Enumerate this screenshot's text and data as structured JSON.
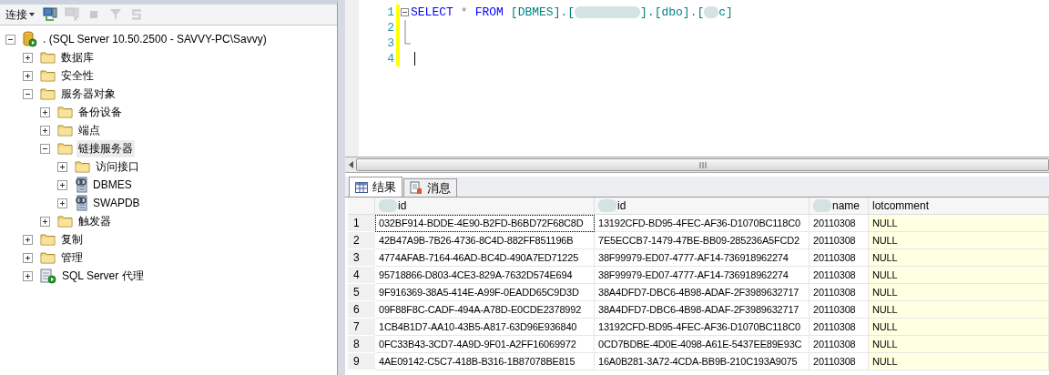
{
  "explorer": {
    "connect_label": "连接",
    "toolbar": [
      {
        "kind": "connect",
        "disabled": false
      },
      {
        "kind": "disconnect",
        "disabled": true
      },
      {
        "kind": "stop",
        "disabled": true
      },
      {
        "kind": "filter",
        "disabled": true
      },
      {
        "kind": "refresh",
        "disabled": true
      }
    ],
    "tree": [
      {
        "label": ". (SQL Server 10.50.2500 - SAVVY-PC\\Savvy)",
        "kind": "server",
        "expanded": true,
        "selected": false,
        "children": [
          {
            "label": "数据库",
            "kind": "folder",
            "expanded": false,
            "selected": false
          },
          {
            "label": "安全性",
            "kind": "folder",
            "expanded": false,
            "selected": false
          },
          {
            "label": "服务器对象",
            "kind": "folder",
            "expanded": true,
            "selected": false,
            "children": [
              {
                "label": "备份设备",
                "kind": "folder",
                "expanded": false,
                "selected": false
              },
              {
                "label": "端点",
                "kind": "folder",
                "expanded": false,
                "selected": false
              },
              {
                "label": "链接服务器",
                "kind": "folder",
                "expanded": true,
                "selected": true,
                "children": [
                  {
                    "label": "访问接口",
                    "kind": "folder",
                    "expanded": false,
                    "selected": false
                  },
                  {
                    "label": "DBMES",
                    "kind": "linked",
                    "expanded": false,
                    "selected": false
                  },
                  {
                    "label": "SWAPDB",
                    "kind": "linked",
                    "expanded": false,
                    "selected": false
                  }
                ]
              },
              {
                "label": "触发器",
                "kind": "folder",
                "expanded": false,
                "selected": false
              }
            ]
          },
          {
            "label": "复制",
            "kind": "folder",
            "expanded": false,
            "selected": false
          },
          {
            "label": "管理",
            "kind": "folder",
            "expanded": false,
            "selected": false
          },
          {
            "label": "SQL Server 代理",
            "kind": "agent",
            "expanded": false,
            "selected": false
          }
        ]
      }
    ]
  },
  "editor": {
    "lines": [
      {
        "number": "1",
        "kind": "fold_start",
        "caret": false,
        "tokens": [
          {
            "kind": "keyword",
            "text": "SELECT"
          },
          {
            "kind": "operator",
            "text": "*"
          },
          {
            "kind": "keyword",
            "text": "FROM"
          },
          {
            "kind": "identifier",
            "text": "[DBMES].["
          },
          {
            "kind": "redacted"
          },
          {
            "kind": "identifier",
            "text": "].[dbo].["
          },
          {
            "kind": "redacted"
          },
          {
            "kind": "identifier",
            "text": "c]"
          }
        ]
      },
      {
        "number": "2",
        "kind": "fold_middle",
        "caret": false
      },
      {
        "number": "3",
        "kind": "fold_end",
        "caret": false
      },
      {
        "number": "4",
        "kind": "plain",
        "caret": true
      }
    ]
  },
  "results": {
    "tabs": [
      {
        "label": "结果",
        "kind": "grid",
        "selected": true
      },
      {
        "label": "消息",
        "kind": "messages",
        "selected": false
      }
    ],
    "columns": [
      {
        "label": "id",
        "redacted": true,
        "highlighted": false
      },
      {
        "label": "id",
        "redacted": true,
        "highlighted": false
      },
      {
        "label": "name",
        "redacted": true,
        "highlighted": false
      },
      {
        "label": "lotcomment",
        "redacted": false,
        "highlighted": true
      }
    ],
    "rows": [
      {
        "number": "1",
        "focused": true,
        "cells": [
          "032BF914-BDDE-4E90-B2FD-B6BD72F68C8D",
          "13192CFD-BD95-4FEC-AF36-D1070BC118C0",
          "20110308",
          "NULL"
        ]
      },
      {
        "number": "2",
        "focused": false,
        "cells": [
          "42B47A9B-7B26-4736-8C4D-882FF851196B",
          "7E5ECCB7-1479-47BE-BB09-285236A5FCD2",
          "20110308",
          "NULL"
        ]
      },
      {
        "number": "3",
        "focused": false,
        "cells": [
          "4774AFAB-7164-46AD-BC4D-490A7ED71225",
          "38F99979-ED07-4777-AF14-736918962274",
          "20110308",
          "NULL"
        ]
      },
      {
        "number": "4",
        "focused": false,
        "cells": [
          "95718866-D803-4CE3-829A-7632D574E694",
          "38F99979-ED07-4777-AF14-736918962274",
          "20110308",
          "NULL"
        ]
      },
      {
        "number": "5",
        "focused": false,
        "cells": [
          "9F916369-38A5-414E-A99F-0EADD65C9D3D",
          "38A4DFD7-DBC6-4B98-ADAF-2F3989632717",
          "20110308",
          "NULL"
        ]
      },
      {
        "number": "6",
        "focused": false,
        "cells": [
          "09F88F8C-CADF-494A-A78D-E0CDE2378992",
          "38A4DFD7-DBC6-4B98-ADAF-2F3989632717",
          "20110308",
          "NULL"
        ]
      },
      {
        "number": "7",
        "focused": false,
        "cells": [
          "1CB4B1D7-AA10-43B5-A817-63D96E936840",
          "13192CFD-BD95-4FEC-AF36-D1070BC118C0",
          "20110308",
          "NULL"
        ]
      },
      {
        "number": "8",
        "focused": false,
        "cells": [
          "0FC33B43-3CD7-4A9D-9F01-A2FF16069972",
          "0CD7BDBE-4D0E-4098-A61E-5437EE89E93C",
          "20110308",
          "NULL"
        ]
      },
      {
        "number": "9",
        "focused": false,
        "cells": [
          "4AE09142-C5C7-418B-B316-1B87078BE815",
          "16A0B281-3A72-4CDA-BB9B-210C193A9075",
          "20110308",
          "NULL"
        ]
      }
    ]
  }
}
